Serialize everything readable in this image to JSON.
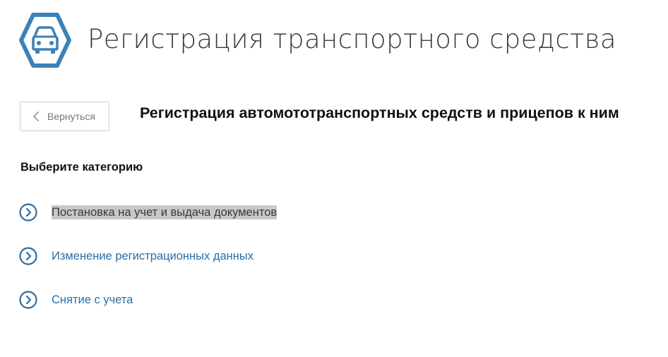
{
  "header": {
    "title": "Регистрация транспортного средства",
    "logo_icon": "car-hexagon-icon"
  },
  "toolbar": {
    "back_label": "Вернуться",
    "back_icon": "chevron-left-icon"
  },
  "main": {
    "section_title": "Регистрация автомототранспортных средств и прицепов к ним",
    "category_heading": "Выберите категорию",
    "categories": [
      {
        "label": "Постановка на учет и выдача документов",
        "icon": "chevron-right-circle-icon",
        "highlighted": true
      },
      {
        "label": "Изменение регистрационных данных",
        "icon": "chevron-right-circle-icon",
        "highlighted": false
      },
      {
        "label": "Снятие с учета",
        "icon": "chevron-right-circle-icon",
        "highlighted": false
      }
    ]
  },
  "colors": {
    "accent": "#2a6ea6",
    "logo": "#3b82b8",
    "highlight": "#c8c8c8"
  }
}
